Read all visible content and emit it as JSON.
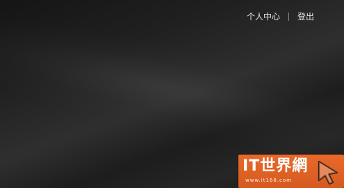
{
  "top_nav": {
    "profile_label": "个人中心",
    "logout_label": "登出"
  },
  "watermark": {
    "title": "IT世界網",
    "subtitle": "www.it168.com"
  },
  "icons": {
    "watermark_cursor": "cursor-arrow-icon"
  },
  "colors": {
    "background": "#1c1c1c",
    "nav_text": "#e6e6e6",
    "watermark_orange": "#e8692a"
  }
}
